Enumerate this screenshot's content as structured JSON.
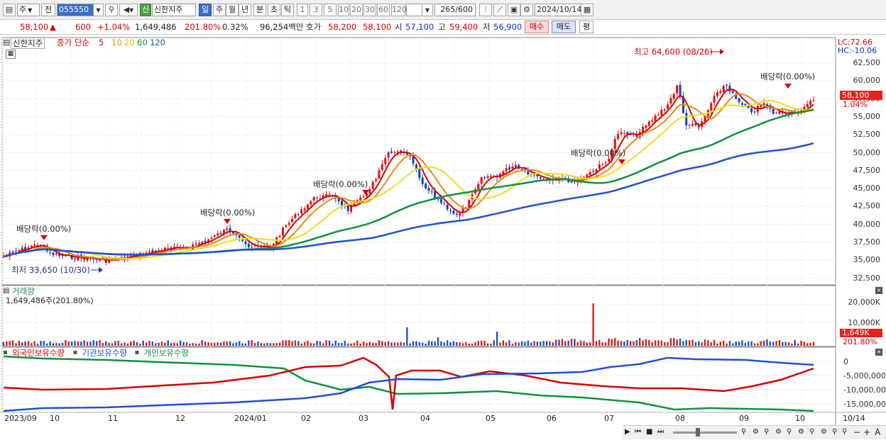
{
  "toolbar": {
    "type_select": "주",
    "prev_label": "전",
    "code": "055550",
    "badge": "신",
    "stock_name": "신한지주",
    "periods": [
      "일",
      "주",
      "월",
      "년",
      "분",
      "초",
      "틱"
    ],
    "active_period": "일",
    "intervals": [
      "1",
      "3",
      "5",
      "10",
      "20",
      "30",
      "60",
      "120"
    ],
    "count": "265",
    "count_max": "/600",
    "date": "2024/10/14"
  },
  "quote": {
    "price": "58,100",
    "arrow": "▲",
    "change": "600",
    "change_pct": "+1.04%",
    "volume": "1,649,486",
    "volume_ratio": "201.80%",
    "turnover": "0.32%",
    "amount": "96,254백만",
    "ask_label": "호가",
    "ask": "58,200",
    "bid": "58,100",
    "open_label": "시",
    "open": "57,100",
    "high_label": "고",
    "high": "59,400",
    "low_label": "저",
    "low": "56,900",
    "buy_button": "매수",
    "sell_button": "매도",
    "eval_button": "평"
  },
  "price_panel": {
    "stock_name": "신한지주",
    "indicator": "종가 단순",
    "ma_periods": [
      "5",
      "10",
      "20",
      "60",
      "120"
    ],
    "ma_colors": [
      "#d80000",
      "#e88a10",
      "#e0c800",
      "#109040",
      "#2050d0"
    ],
    "lc": "LC:72.66",
    "hc": "HC:-10.06",
    "last_price": "58,100",
    "last_pct": "1.04%",
    "high_annotation": "최고 64,600 (08/26)",
    "low_annotation": "최저 33,650 (10/30)",
    "dividend_annotation": "배당락(0.00%)",
    "yaxis": [
      "62,500",
      "60,000",
      "57,500",
      "55,000",
      "52,500",
      "50,000",
      "47,500",
      "45,000",
      "42,500",
      "40,000",
      "37,500",
      "35,000",
      "32,500"
    ]
  },
  "volume_panel": {
    "title": "거래량",
    "value": "1,649,486주(201.80%)",
    "yaxis": [
      "20,000K",
      "10,000K"
    ],
    "last": "1,649K",
    "last_pct": "201.80%"
  },
  "holdings_panel": {
    "legend": [
      "외국인보유수량",
      "기관보유수량",
      "개인보유수량"
    ],
    "legend_colors": [
      "#d80000",
      "#2050d0",
      "#109040"
    ],
    "yaxis": [
      "0",
      "-5,000,000",
      "-10,000,000",
      "-15,000,000"
    ]
  },
  "xaxis": [
    "2023/09",
    "10",
    "11",
    "12",
    "2024/01",
    "02",
    "03",
    "04",
    "05",
    "06",
    "07",
    "08",
    "09",
    "10"
  ],
  "end_date": "10/14"
}
